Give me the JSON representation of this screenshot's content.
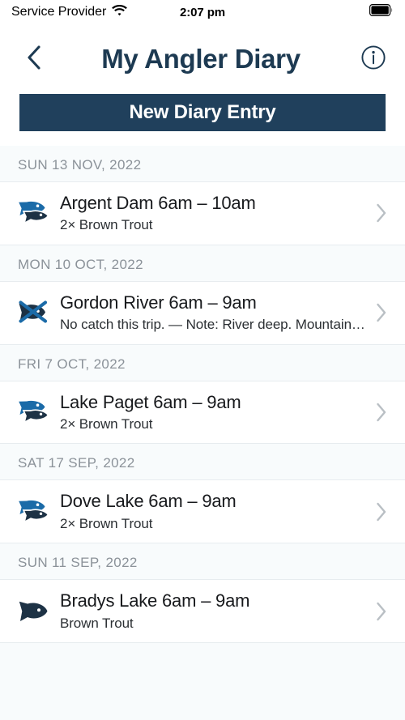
{
  "status_bar": {
    "carrier": "Service Provider",
    "wifi_icon": "wifi-icon",
    "time": "2:07 pm",
    "battery_icon": "battery-full-icon"
  },
  "header": {
    "back_icon": "chevron-left-icon",
    "title": "My Angler Diary",
    "info_icon": "info-circle-icon"
  },
  "actions": {
    "new_entry_label": "New Diary Entry"
  },
  "colors": {
    "navy": "#20405c",
    "title_navy": "#1d3a52",
    "fish_blue": "#1b6ba8",
    "fish_dark": "#1d3245",
    "page_bg": "#f8fbfc",
    "row_bg": "#ffffff",
    "divider": "#e7ecef",
    "date_text": "#8b9299",
    "chevron": "#b9bfc4"
  },
  "sections": [
    {
      "date": "SUN 13 NOV, 2022",
      "entries": [
        {
          "icon": "two-fish-icon",
          "title": "Argent Dam 6am – 10am",
          "subtitle": "2× Brown Trout",
          "chevron_icon": "chevron-right-icon"
        }
      ]
    },
    {
      "date": "MON 10 OCT, 2022",
      "entries": [
        {
          "icon": "no-catch-fish-icon",
          "title": "Gordon River 6am – 9am",
          "subtitle": "No catch this trip. — Note: River deep. Mountain hig…",
          "chevron_icon": "chevron-right-icon"
        }
      ]
    },
    {
      "date": "FRI 7 OCT, 2022",
      "entries": [
        {
          "icon": "two-fish-icon",
          "title": "Lake Paget 6am – 9am",
          "subtitle": "2× Brown Trout",
          "chevron_icon": "chevron-right-icon"
        }
      ]
    },
    {
      "date": "SAT 17 SEP, 2022",
      "entries": [
        {
          "icon": "two-fish-icon",
          "title": "Dove Lake 6am – 9am",
          "subtitle": "2× Brown Trout",
          "chevron_icon": "chevron-right-icon"
        }
      ]
    },
    {
      "date": "SUN 11 SEP, 2022",
      "entries": [
        {
          "icon": "one-fish-icon",
          "title": "Bradys Lake 6am – 9am",
          "subtitle": "Brown Trout",
          "chevron_icon": "chevron-right-icon"
        }
      ]
    }
  ]
}
